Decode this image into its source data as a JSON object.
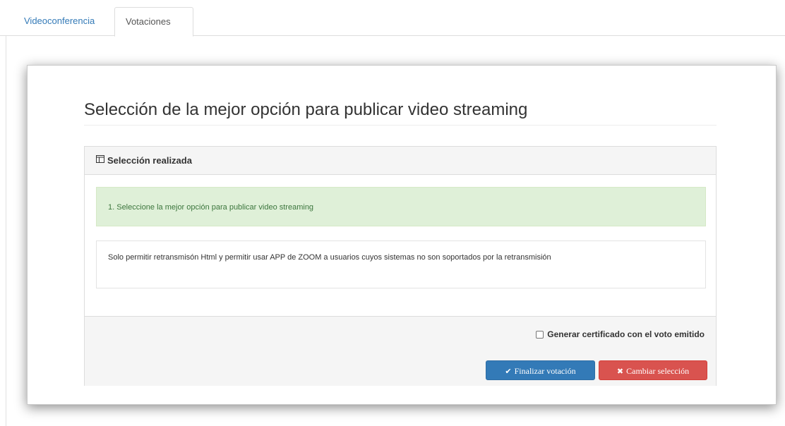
{
  "tabs": {
    "items": [
      {
        "label": "Videoconferencia",
        "active": false
      },
      {
        "label": "Votaciones",
        "active": true
      }
    ]
  },
  "vote": {
    "title": "Selección de la mejor opción para publicar video streaming",
    "panel": {
      "heading_icon": "table-icon",
      "heading": "Selección realizada",
      "question": "1. Seleccione la mejor opción para publicar video streaming",
      "selected_option": "Solo permitir retransmisón Html y permitir usar APP de ZOOM a usuarios cuyos sistemas no son soportados por la retransmisión"
    },
    "footer": {
      "certificate_label": "Generar certificado con el voto emitido",
      "certificate_checked": false,
      "finish_button": "Finalizar votación",
      "finish_icon": "check-icon",
      "change_button": "Cambiar selección",
      "change_icon": "x-icon"
    }
  },
  "colors": {
    "link": "#337ab7",
    "success_bg": "#dff0d8",
    "success_text": "#3c763d",
    "primary": "#337ab7",
    "danger": "#d9534f"
  }
}
